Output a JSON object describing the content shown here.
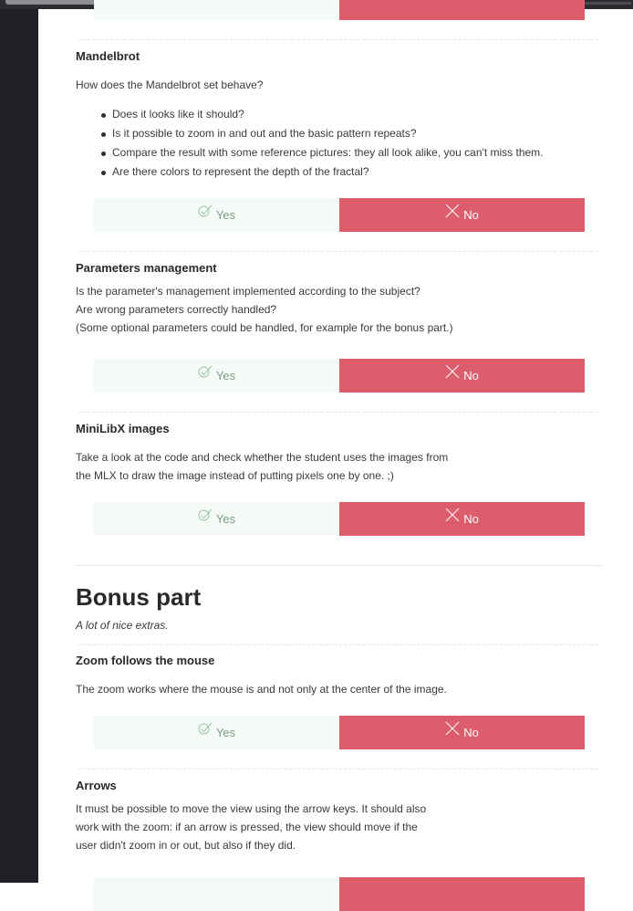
{
  "buttons": {
    "yes_label": "Yes",
    "no_label": "No"
  },
  "questions": [
    {
      "title": "Mandelbrot",
      "text": [
        "How does the Mandelbrot set behave?"
      ],
      "bullets": [
        "Does it looks like it should?",
        "Is it possible to zoom in and out and the basic pattern repeats?",
        "Compare the result with some reference pictures: they all look alike, you can't miss them.",
        "Are there colors to represent the depth of the fractal?"
      ]
    },
    {
      "title": "Parameters management",
      "text": [
        "Is the parameter's management implemented according to the subject?",
        "Are wrong parameters correctly handled?",
        "(Some optional parameters could be handled, for example for the bonus part.)"
      ]
    },
    {
      "title": "MiniLibX images",
      "text": [
        "Take a look at the code and check whether the student uses the images from",
        "the MLX to draw the image instead of putting pixels one by one. ;)"
      ]
    },
    {
      "title": "Zoom follows the mouse",
      "text": [
        "The zoom works where the mouse is and not only at the center of the image."
      ]
    },
    {
      "title": "Arrows",
      "text": [
        "It must be possible to move the view using the arrow keys. It should also",
        "work with the zoom: if an arrow is pressed, the view should move if the",
        "user didn't zoom in or out, but also if they did."
      ]
    }
  ],
  "bonus": {
    "title": "Bonus part",
    "subtitle": "A lot of nice extras."
  },
  "colors": {
    "yes_bg": "#f4fbf6",
    "yes_text": "#7d9c87",
    "no_bg": "#dc5d6b",
    "no_text": "#ffffff",
    "sidebar": "#1f2127"
  }
}
